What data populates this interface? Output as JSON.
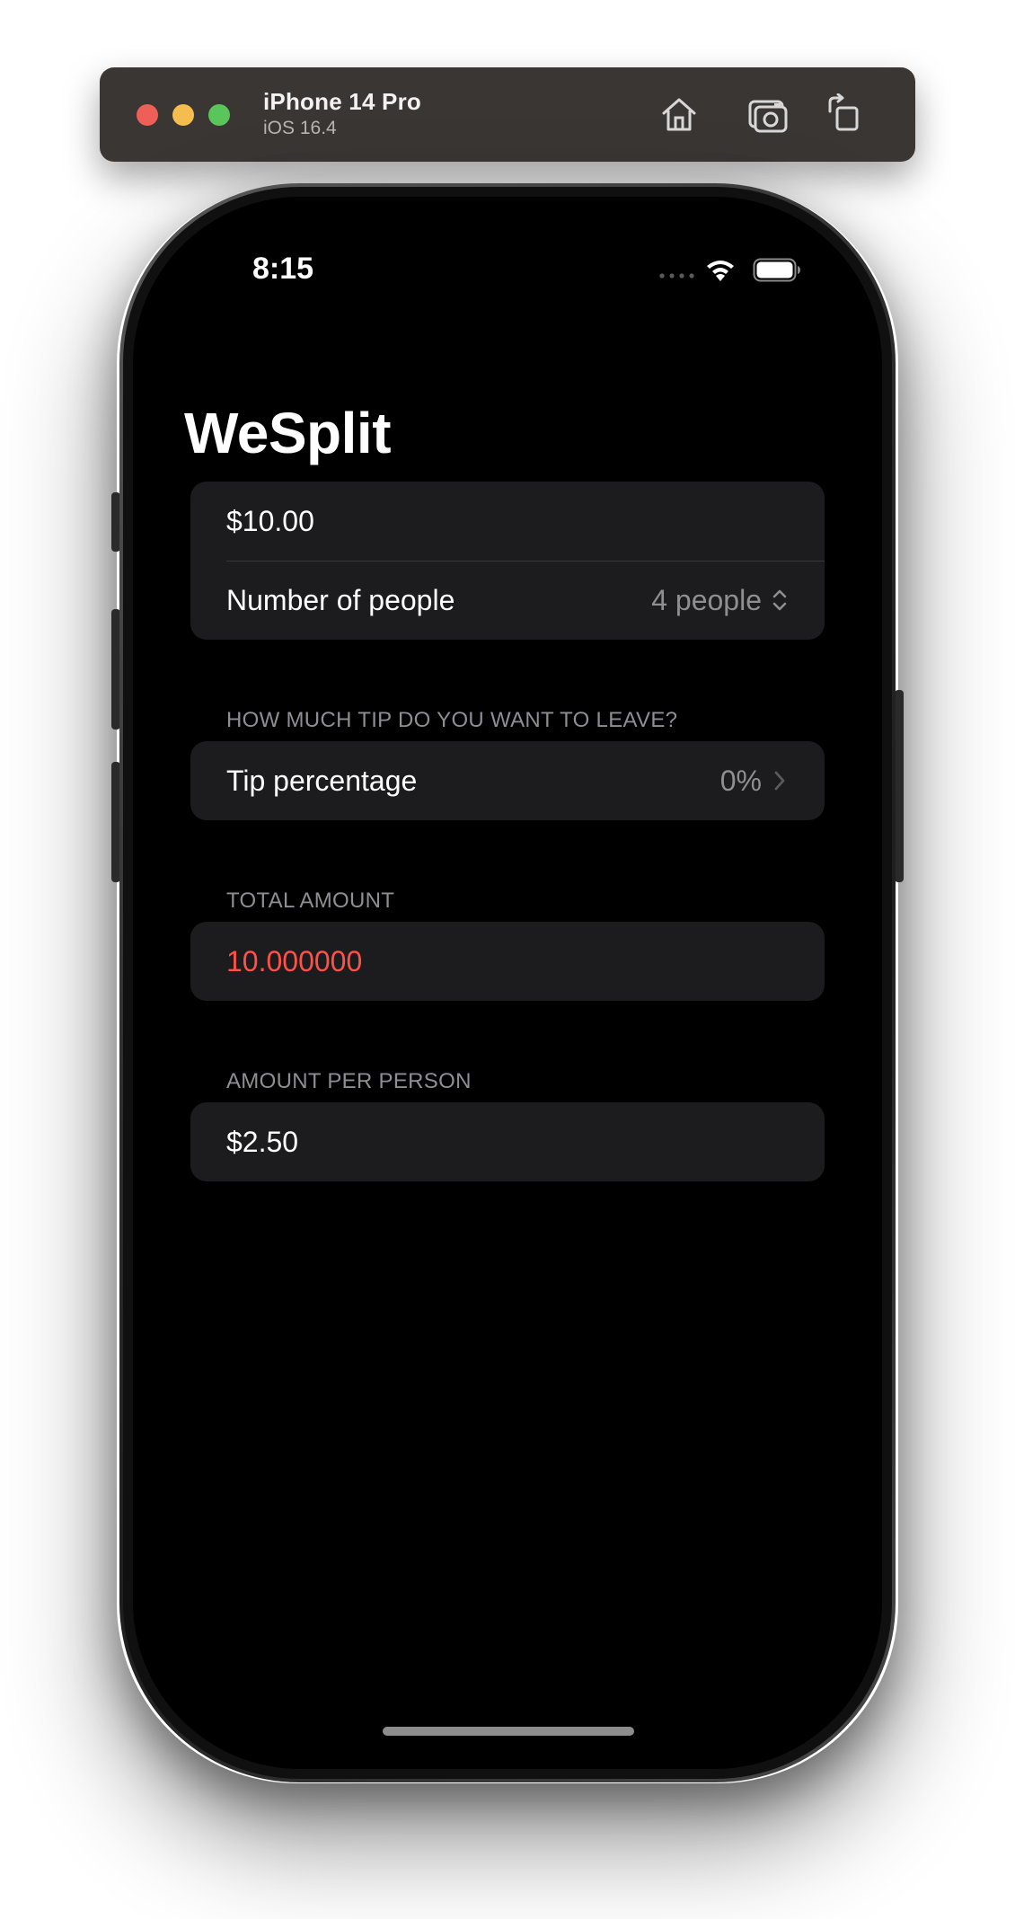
{
  "simulator": {
    "device_name": "iPhone 14 Pro",
    "os_version": "iOS 16.4",
    "toolbar_icons": [
      "home-icon",
      "screenshot-icon",
      "rotate-icon"
    ]
  },
  "status_bar": {
    "time": "8:15"
  },
  "app": {
    "title": "WeSplit",
    "amount_field": {
      "value": "$10.00"
    },
    "people_row": {
      "label": "Number of people",
      "value": "4 people"
    },
    "tip_section": {
      "header": "HOW MUCH TIP DO YOU WANT TO LEAVE?",
      "label": "Tip percentage",
      "value": "0%"
    },
    "total_section": {
      "header": "TOTAL AMOUNT",
      "value": "10.000000"
    },
    "per_person_section": {
      "header": "AMOUNT PER PERSON",
      "value": "$2.50"
    }
  },
  "colors": {
    "background": "#000000",
    "cell_background": "#1c1c1e",
    "secondary_text": "#8e8e93",
    "total_text": "#ff5146"
  }
}
